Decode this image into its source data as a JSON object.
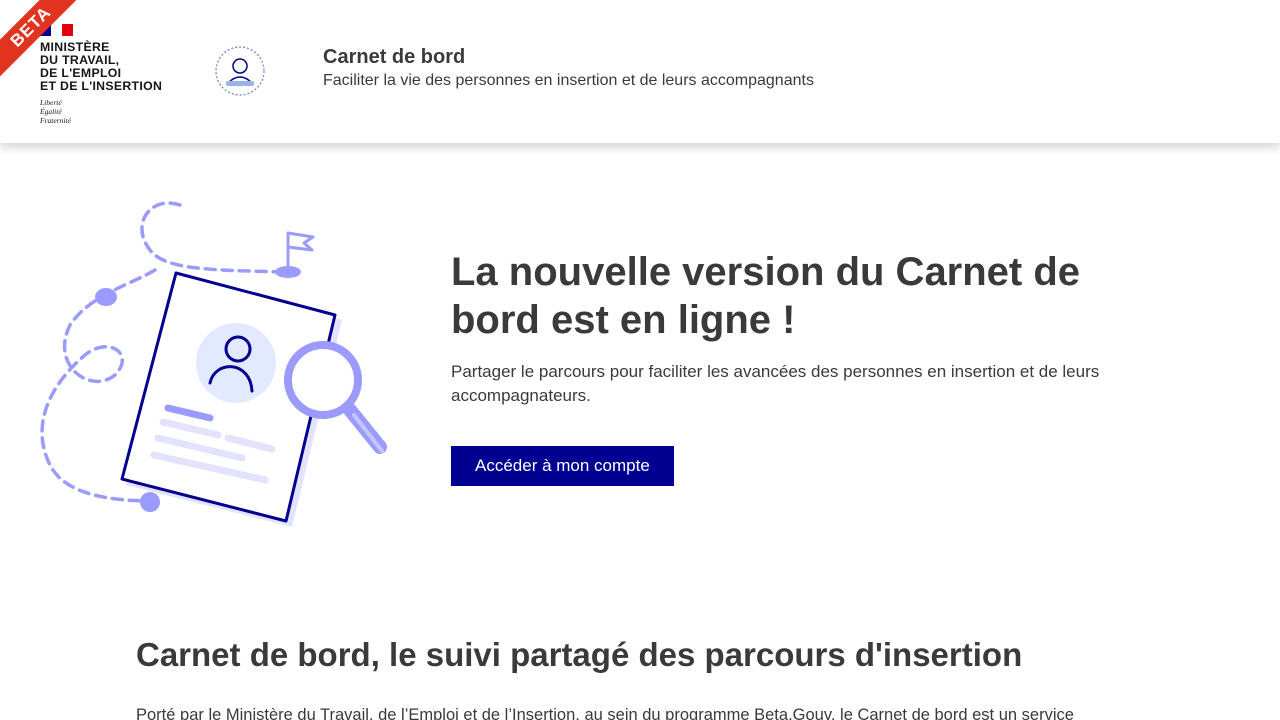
{
  "beta_label": "BETA",
  "header": {
    "ministry": {
      "line1": "MINISTÈRE",
      "line2": "DU TRAVAIL,",
      "line3": "DE L'EMPLOI",
      "line4": "ET DE L'INSERTION",
      "motto1": "Liberté",
      "motto2": "Égalité",
      "motto3": "Fraternité"
    },
    "operator_logo_icon": "person-badge-icon",
    "title": "Carnet de bord",
    "tagline": "Faciliter la vie des personnes en insertion et de leurs accompagnants"
  },
  "hero": {
    "illustration_icon": "profile-card-magnifier-illustration",
    "title": "La nouvelle version du Carnet de bord est en ligne !",
    "description": "Partager le parcours pour faciliter les avancées des personnes en insertion et de leurs accompagnateurs.",
    "cta_label": "Accéder à mon compte"
  },
  "section": {
    "title": "Carnet de bord, le suivi partagé des parcours d'insertion",
    "text": "Porté par le Ministère du Travail, de l’Emploi et de l’Insertion, au sein du programme Beta.Gouv, le Carnet de bord est un service"
  },
  "colors": {
    "primary": "#000091",
    "beta": "#e1341e",
    "illustration_light": "#9a9aff",
    "illustration_pale": "#e3e3fd"
  }
}
